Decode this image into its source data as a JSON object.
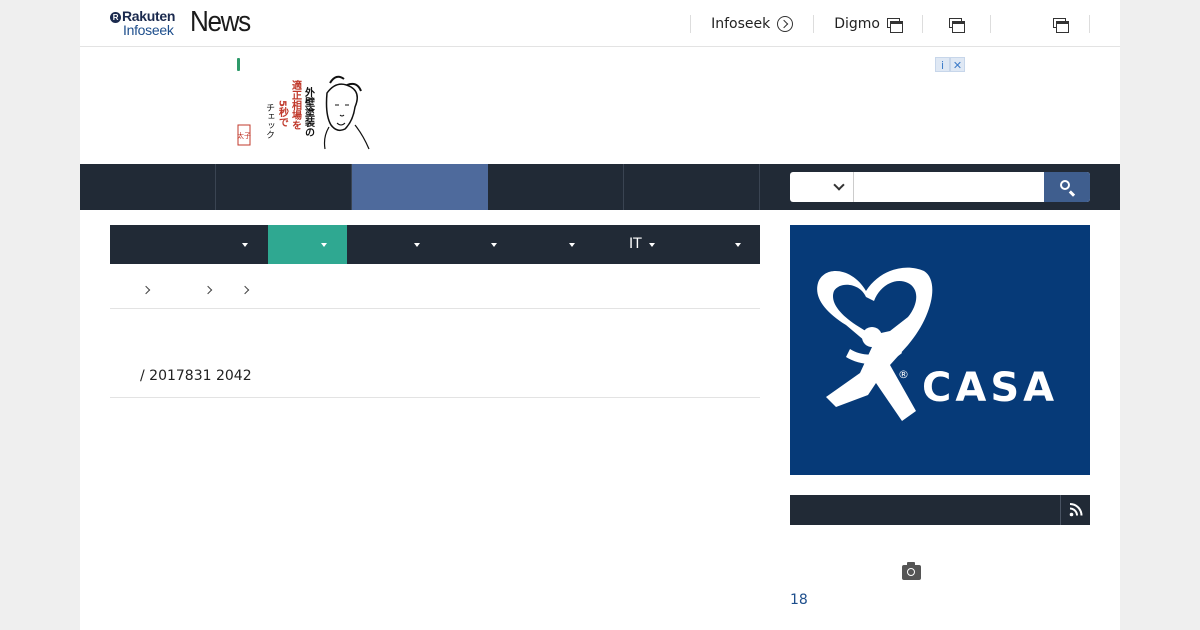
{
  "header": {
    "logo_rakuten": "Rakuten",
    "logo_infoseek": "Infoseek",
    "logo_news": "News",
    "nav": [
      {
        "label": "Infoseek",
        "icon": "circle-arrow-icon"
      },
      {
        "label": "Digmo",
        "icon": "new-window-icon"
      },
      {
        "label": "",
        "icon": "new-window-icon"
      },
      {
        "label": "",
        "icon": "new-window-icon"
      }
    ]
  },
  "ad": {
    "info_glyph": "i",
    "close_glyph": "✕",
    "art_text": [
      "外壁塗装の",
      "適正相場を",
      "5秒で",
      "チェック"
    ],
    "stamp_text": "太子"
  },
  "mainnav": {
    "tab_count_note": "",
    "active_tab_index": 2
  },
  "search": {
    "selected_option": "",
    "placeholder": "",
    "icon": "search-icon"
  },
  "categories": [
    {
      "label": "",
      "active": false
    },
    {
      "label": "",
      "active": true
    },
    {
      "label": "",
      "active": false
    },
    {
      "label": "",
      "active": false
    },
    {
      "label": "",
      "active": false
    },
    {
      "label": "IT",
      "active": false
    },
    {
      "label": "",
      "active": false
    }
  ],
  "article": {
    "dateline": "/ 2017831 2042"
  },
  "sidebar": {
    "ad_brand": "CASA",
    "ad_registered": "®",
    "ranking_title": "",
    "ranking_first_number": "18"
  },
  "colors": {
    "nav_dark": "#212a36",
    "nav_active": "#4e6a9c",
    "category_active": "#2fa891",
    "casa_blue": "#063a78",
    "link_blue": "#1d4e8c"
  }
}
